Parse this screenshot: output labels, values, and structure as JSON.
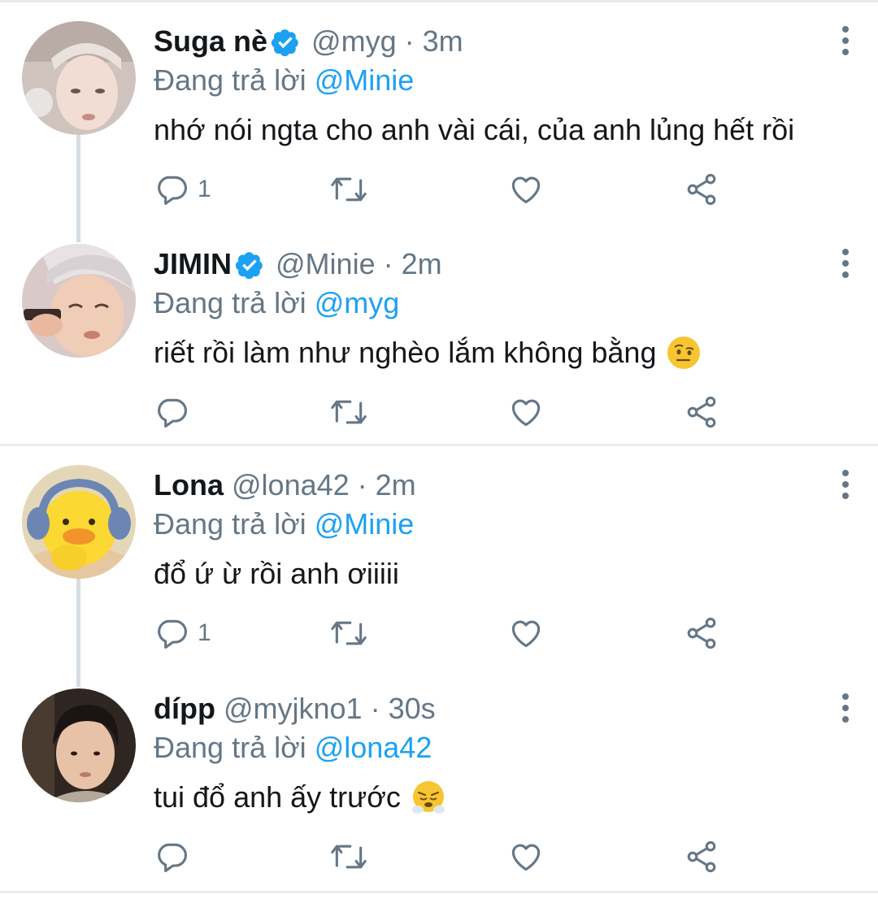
{
  "colors": {
    "accent": "#1da1f2",
    "muted": "#657786",
    "text": "#14171a",
    "divider": "#e6ecf0"
  },
  "tweets": [
    {
      "name": "Suga nè",
      "verified": true,
      "handle": "@myg",
      "sep": "·",
      "time": "3m",
      "reply_prefix": "Đang trả lời",
      "reply_to": "@Minie",
      "text": "nhớ nói ngta cho anh vài cái, của anh lủng hết rồi",
      "reply_count": "1",
      "avatar_icon": "avatar-photo"
    },
    {
      "name": "JIMIN",
      "verified": true,
      "handle": "@Minie",
      "sep": "·",
      "time": "2m",
      "reply_prefix": "Đang trả lời",
      "reply_to": "@myg",
      "text": "riết rồi làm như nghèo lắm không bằng",
      "reply_count": "",
      "emoji": "face-with-raised-eyebrow-emoji",
      "avatar_icon": "avatar-photo"
    },
    {
      "name": "Lona",
      "verified": false,
      "handle": "@lona42",
      "sep": "·",
      "time": "2m",
      "reply_prefix": "Đang trả lời",
      "reply_to": "@Minie",
      "text": "đổ ứ ừ rồi anh ơiiiii",
      "reply_count": "1",
      "avatar_icon": "duck-avatar"
    },
    {
      "name": "dípp",
      "verified": false,
      "handle": "@myjkno1",
      "sep": "·",
      "time": "30s",
      "reply_prefix": "Đang trả lời",
      "reply_to": "@lona42",
      "text": "tui đổ anh ấy trước",
      "reply_count": "",
      "emoji": "face-with-steam-emoji",
      "avatar_icon": "avatar-photo"
    }
  ]
}
